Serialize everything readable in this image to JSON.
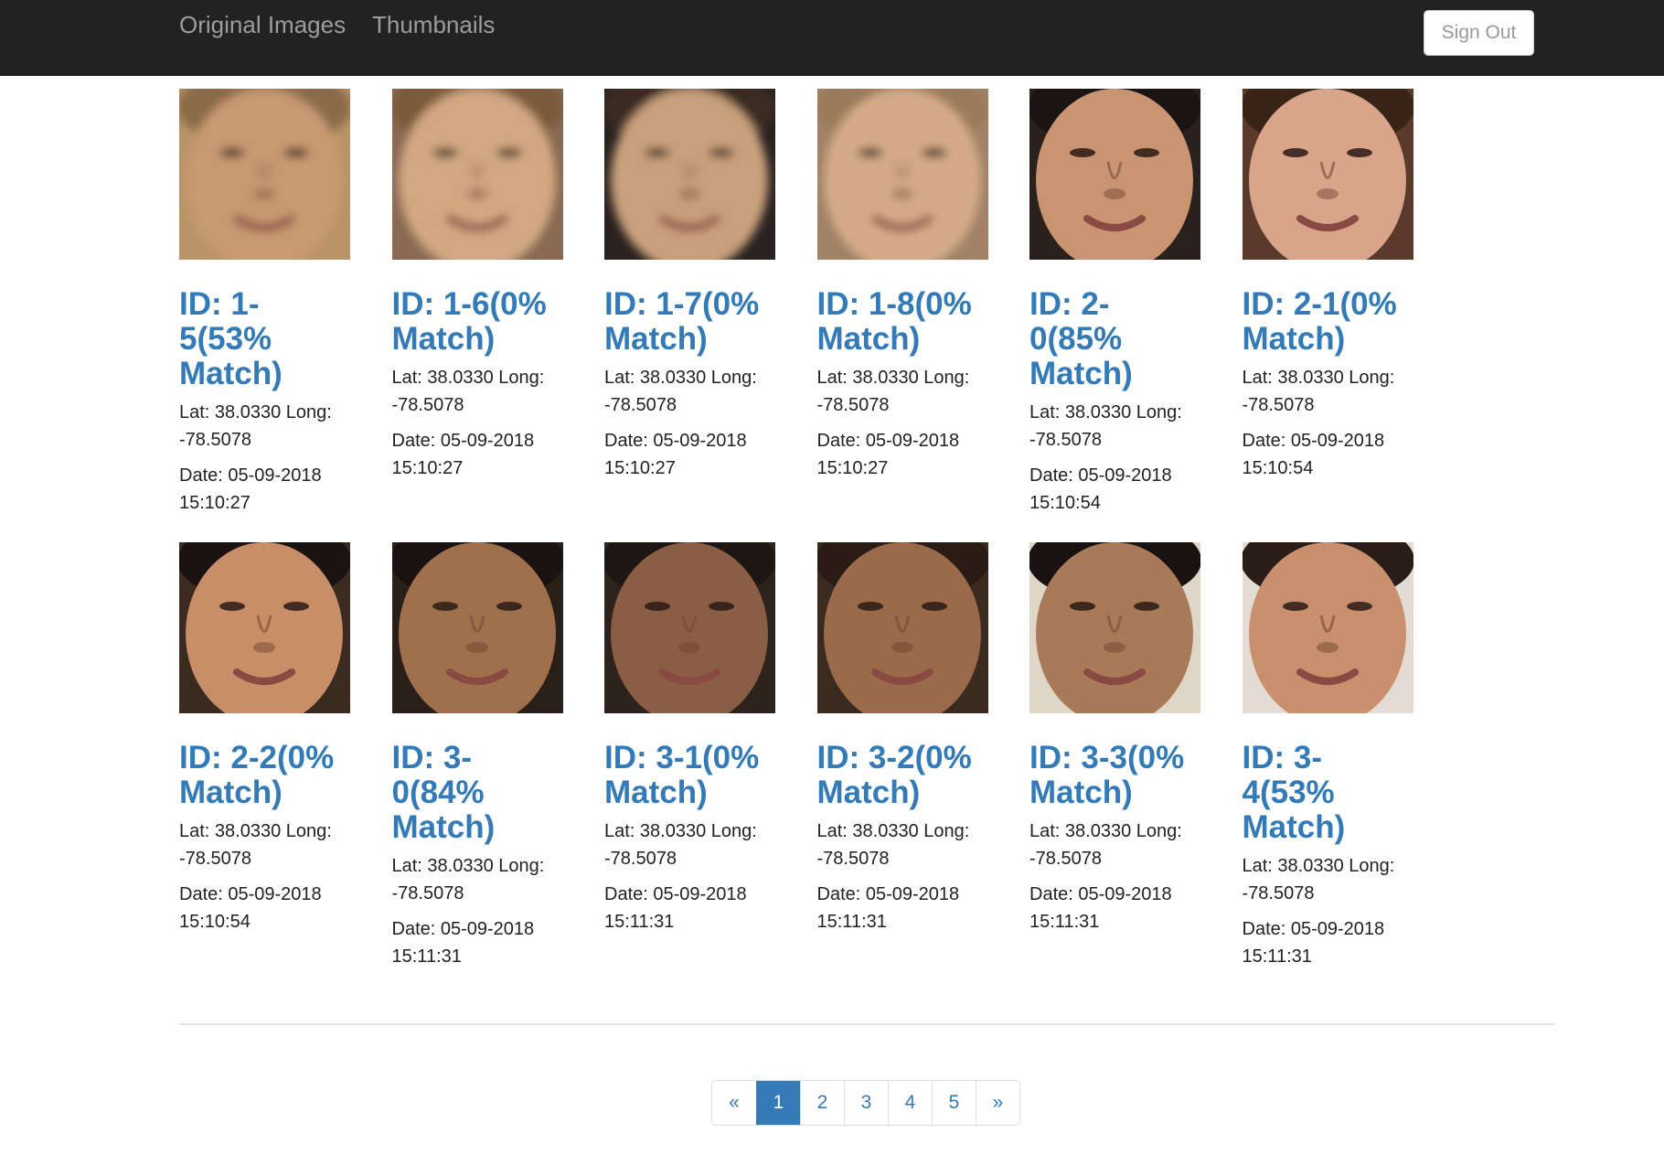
{
  "navbar": {
    "links": [
      "Original Images",
      "Thumbnails"
    ],
    "sign_out_label": "Sign Out"
  },
  "cards": [
    {
      "title": "ID: 1-5(53% Match)",
      "location": "Lat: 38.0330 Long: -78.5078",
      "date": "Date: 05-09-2018 15:10:27",
      "skin": "#c89a72",
      "hair": "#8a6a4a",
      "bg": "#b89468",
      "blur": true
    },
    {
      "title": "ID: 1-6(0% Match)",
      "location": "Lat: 38.0330 Long: -78.5078",
      "date": "Date: 05-09-2018 15:10:27",
      "skin": "#d2a882",
      "hair": "#7a5a3a",
      "bg": "#8a6a52",
      "blur": true
    },
    {
      "title": "ID: 1-7(0% Match)",
      "location": "Lat: 38.0330 Long: -78.5078",
      "date": "Date: 05-09-2018 15:10:27",
      "skin": "#c9a07c",
      "hair": "#3a2a22",
      "bg": "#2a2220",
      "blur": true
    },
    {
      "title": "ID: 1-8(0% Match)",
      "location": "Lat: 38.0330 Long: -78.5078",
      "date": "Date: 05-09-2018 15:10:27",
      "skin": "#d4ab86",
      "hair": "#9a7a5a",
      "bg": "#a08266",
      "blur": true
    },
    {
      "title": "ID: 2-0(85% Match)",
      "location": "Lat: 38.0330 Long: -78.5078",
      "date": "Date: 05-09-2018 15:10:54",
      "skin": "#c99472",
      "hair": "#1a1414",
      "bg": "#2a201c",
      "blur": false
    },
    {
      "title": "ID: 2-1(0% Match)",
      "location": "Lat: 38.0330 Long: -78.5078",
      "date": "Date: 05-09-2018 15:10:54",
      "skin": "#d8a48a",
      "hair": "#3a2418",
      "bg": "#5a3a2a",
      "blur": false
    },
    {
      "title": "ID: 2-2(0% Match)",
      "location": "Lat: 38.0330 Long: -78.5078",
      "date": "Date: 05-09-2018 15:10:54",
      "skin": "#c88e68",
      "hair": "#1a1210",
      "bg": "#3a2a20",
      "blur": false
    },
    {
      "title": "ID: 3-0(84% Match)",
      "location": "Lat: 38.0330 Long: -78.5078",
      "date": "Date: 05-09-2018 15:11:31",
      "skin": "#a0704c",
      "hair": "#1a1210",
      "bg": "#2a1e18",
      "blur": false
    },
    {
      "title": "ID: 3-1(0% Match)",
      "location": "Lat: 38.0330 Long: -78.5078",
      "date": "Date: 05-09-2018 15:11:31",
      "skin": "#8a5e44",
      "hair": "#1e1612",
      "bg": "#2e221c",
      "blur": false
    },
    {
      "title": "ID: 3-2(0% Match)",
      "location": "Lat: 38.0330 Long: -78.5078",
      "date": "Date: 05-09-2018 15:11:31",
      "skin": "#9a6a4a",
      "hair": "#2a1c14",
      "bg": "#3a2a20",
      "blur": false
    },
    {
      "title": "ID: 3-3(0% Match)",
      "location": "Lat: 38.0330 Long: -78.5078",
      "date": "Date: 05-09-2018 15:11:31",
      "skin": "#a87a58",
      "hair": "#1a1210",
      "bg": "#e0d6c8",
      "blur": false
    },
    {
      "title": "ID: 3-4(53% Match)",
      "location": "Lat: 38.0330 Long: -78.5078",
      "date": "Date: 05-09-2018 15:11:31",
      "skin": "#c8906c",
      "hair": "#2a1c16",
      "bg": "#e4dcd4",
      "blur": false
    }
  ],
  "pagination": {
    "prev_label": "«",
    "pages": [
      "1",
      "2",
      "3",
      "4",
      "5"
    ],
    "active_page": "1",
    "next_label": "»"
  }
}
